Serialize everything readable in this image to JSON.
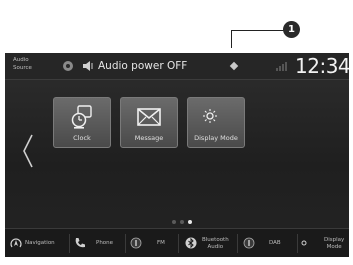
{
  "callout": {
    "number": "1"
  },
  "status_bar": {
    "source_line1": "Audio",
    "source_line2": "Source",
    "audio_status": "Audio power OFF",
    "clock": "12:34"
  },
  "tiles": [
    {
      "label": "Clock",
      "icon": "clock-icon"
    },
    {
      "label": "Message",
      "icon": "envelope-icon"
    },
    {
      "label": "Display Mode",
      "icon": "sun-moon-icon"
    }
  ],
  "pager": {
    "pages": 3,
    "active": 3
  },
  "bottom_bar": {
    "items": [
      {
        "label": "Navigation",
        "icon": "navigation-icon"
      },
      {
        "label": "Phone",
        "icon": "phone-icon"
      },
      {
        "label": "FM",
        "icon": "fm-icon"
      },
      {
        "label_line1": "Bluetooth",
        "label_line2": "Audio",
        "icon": "bluetooth-icon"
      },
      {
        "label": "DAB",
        "icon": "dab-icon"
      },
      {
        "label_line1": "Display",
        "label_line2": "Mode",
        "icon": "display-mode-icon"
      }
    ]
  },
  "colors": {
    "screen_bg": "#242424",
    "tile_bg": "#5a5a5a",
    "text": "#e6e6e6"
  }
}
